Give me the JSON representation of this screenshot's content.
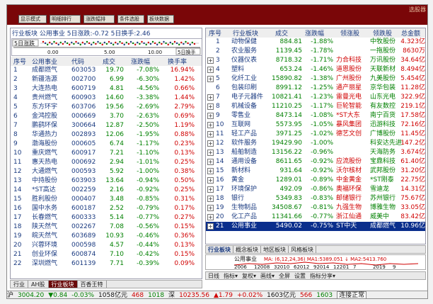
{
  "title_bar": {
    "left_text": "",
    "right_text": "选股器"
  },
  "toolbar": [
    "显示模式",
    "明细排行",
    "涨跌幅排",
    "条件选股",
    "板块数据"
  ],
  "left_panel": {
    "header": "行业板块 公用事业 5日涨跌:-0.72 5日换手:2.46",
    "chart": {
      "tag": "5日涨跌",
      "axis": [
        "0.00",
        "5.00",
        "10.00"
      ],
      "right_label": "5日换手"
    },
    "columns": [
      "序号",
      "公用事业",
      "代码",
      "成交",
      "涨跌幅",
      "换手率"
    ],
    "rows": [
      {
        "n": "1",
        "name": "成都燃气",
        "code": "603053",
        "price": "19.70",
        "chg": "-7.08%",
        "turn": "16.94%"
      },
      {
        "n": "2",
        "name": "新疆浩源",
        "code": "002700",
        "price": "6.99",
        "chg": "-6.30%",
        "turn": "1.42%"
      },
      {
        "n": "3",
        "name": "大连热电",
        "code": "600719",
        "price": "4.81",
        "chg": "-4.56%",
        "turn": "0.66%"
      },
      {
        "n": "4",
        "name": "贵州燃气",
        "code": "600903",
        "price": "14.60",
        "chg": "-3.38%",
        "turn": "1.44%"
      },
      {
        "n": "5",
        "name": "东方环宇",
        "code": "603706",
        "price": "19.56",
        "chg": "-2.69%",
        "turn": "2.79%"
      },
      {
        "n": "6",
        "name": "金鸿控股",
        "code": "000669",
        "price": "3.70",
        "chg": "-2.63%",
        "turn": "0.69%"
      },
      {
        "n": "7",
        "name": "鹏鹞环保",
        "code": "300664",
        "price": "12.87",
        "chg": "-2.50%",
        "turn": "1.19%"
      },
      {
        "n": "8",
        "name": "华通热力",
        "code": "002893",
        "price": "12.06",
        "chg": "-1.95%",
        "turn": "0.88%"
      },
      {
        "n": "9",
        "name": "渤海股份",
        "code": "000605",
        "price": "6.74",
        "chg": "-1.17%",
        "turn": "0.23%"
      },
      {
        "n": "10",
        "name": "重庆燃气",
        "code": "600917",
        "price": "7.21",
        "chg": "-1.10%",
        "turn": "0.13%"
      },
      {
        "n": "11",
        "name": "惠天热电",
        "code": "000692",
        "price": "2.94",
        "chg": "-1.01%",
        "turn": "0.25%"
      },
      {
        "n": "12",
        "name": "大通燃气",
        "code": "000593",
        "price": "5.92",
        "chg": "-1.00%",
        "turn": "0.38%"
      },
      {
        "n": "13",
        "name": "中持股份",
        "code": "603903",
        "price": "13.64",
        "chg": "-0.94%",
        "turn": "0.50%"
      },
      {
        "n": "14",
        "name": "*ST高达",
        "code": "002259",
        "price": "2.16",
        "chg": "-0.92%",
        "turn": "0.25%"
      },
      {
        "n": "15",
        "name": "胜利股份",
        "code": "000407",
        "price": "3.48",
        "chg": "-0.85%",
        "turn": "0.31%"
      },
      {
        "n": "16",
        "name": "国中水务",
        "code": "600187",
        "price": "2.52",
        "chg": "-0.79%",
        "turn": "0.17%"
      },
      {
        "n": "17",
        "name": "长春燃气",
        "code": "600333",
        "price": "5.14",
        "chg": "-0.77%",
        "turn": "0.27%"
      },
      {
        "n": "18",
        "name": "陕天然气",
        "code": "002267",
        "price": "7.08",
        "chg": "-0.56%",
        "turn": "0.15%"
      },
      {
        "n": "19",
        "name": "皖天然气",
        "code": "603689",
        "price": "10.93",
        "chg": "-0.46%",
        "turn": "0.36%"
      },
      {
        "n": "20",
        "name": "兴蓉环境",
        "code": "000598",
        "price": "4.57",
        "chg": "-0.44%",
        "turn": "0.13%"
      },
      {
        "n": "21",
        "name": "创业环保",
        "code": "600874",
        "price": "7.10",
        "chg": "-0.42%",
        "turn": "0.15%"
      },
      {
        "n": "22",
        "name": "深圳燃气",
        "code": "601139",
        "price": "7.71",
        "chg": "-0.39%",
        "turn": "0.09%"
      }
    ]
  },
  "right_panel": {
    "columns": [
      "序号",
      "行业板块",
      "成交",
      "涨跌幅",
      "领涨股",
      "领跌股",
      "总金额"
    ],
    "rows": [
      {
        "n": "1",
        "name": "动物保健",
        "price": "884.81",
        "chg": "-1.88%",
        "up": "",
        "down": "中牧股份",
        "amt": "4.323亿"
      },
      {
        "n": "2",
        "name": "农业服务",
        "price": "1139.45",
        "chg": "-1.78%",
        "up": "",
        "down": "一拖股份",
        "amt": "8630万"
      },
      {
        "n": "3",
        "name": "仪器仪表",
        "price": "8718.32",
        "chg": "-1.71%",
        "up": "力合科技",
        "down": "万讯股份",
        "amt": "34.64亿"
      },
      {
        "n": "4",
        "name": "塑料",
        "price": "653.24",
        "chg": "-1.46%",
        "up": "道恩股份",
        "down": "天联新材",
        "amt": "8.494亿"
      },
      {
        "n": "5",
        "name": "化纤工业",
        "price": "15890.82",
        "chg": "-1.38%",
        "up": "广州股份",
        "down": "九美股份",
        "amt": "5.454亿"
      },
      {
        "n": "6",
        "name": "包装印刷",
        "price": "8991.12",
        "chg": "-1.25%",
        "up": "通产丽星",
        "down": "京华包装",
        "amt": "11.28亿"
      },
      {
        "n": "7",
        "name": "电子元器件",
        "price": "10821.41",
        "chg": "-1.23%",
        "up": "雷曼光电",
        "down": "山东光电",
        "amt": "322.9亿"
      },
      {
        "n": "8",
        "name": "机械设备",
        "price": "11210.25",
        "chg": "-1.17%",
        "up": "巨轮智能",
        "down": "有友数控",
        "amt": "219.1亿"
      },
      {
        "n": "9",
        "name": "零售业",
        "price": "8473.14",
        "chg": "-1.08%",
        "up": "*ST大东",
        "down": "南宁百货",
        "amt": "17.58亿"
      },
      {
        "n": "10",
        "name": "互联网",
        "price": "5573.95",
        "chg": "-1.05%",
        "up": "暴风集团",
        "down": "迅游科技",
        "amt": "72.16亿"
      },
      {
        "n": "11",
        "name": "轻工产品",
        "price": "3971.25",
        "chg": "-1.02%",
        "up": "德艺文创",
        "down": "广博股份",
        "amt": "11.45亿"
      },
      {
        "n": "12",
        "name": "软件服务",
        "price": "19429.90",
        "chg": "-1.00%",
        "up": "",
        "down": "科安达先进通",
        "amt": "147.2亿"
      },
      {
        "n": "13",
        "name": "船舶制造",
        "price": "13156.22",
        "chg": "-0.96%",
        "up": "",
        "down": "天海防务",
        "amt": "3.674亿"
      },
      {
        "n": "14",
        "name": "通用设备",
        "price": "8611.65",
        "chg": "-0.92%",
        "up": "应流股份",
        "down": "宝鼎科技",
        "amt": "61.40亿"
      },
      {
        "n": "15",
        "name": "新材料",
        "price": "931.64",
        "chg": "-0.92%",
        "up": "沃尔核材",
        "down": "武邦股份",
        "amt": "31.20亿"
      },
      {
        "n": "16",
        "name": "黄金",
        "price": "1289.01",
        "chg": "-0.89%",
        "up": "中金黄金",
        "down": "*ST刚泰",
        "amt": "22.75亿"
      },
      {
        "n": "17",
        "name": "环境保护",
        "price": "492.09",
        "chg": "-0.86%",
        "up": "奥福环保",
        "down": "雪迪龙",
        "amt": "14.31亿"
      },
      {
        "n": "18",
        "name": "银行",
        "price": "5349.83",
        "chg": "-0.83%",
        "up": "邮储银行",
        "down": "苏州银行",
        "amt": "75.67亿"
      },
      {
        "n": "19",
        "name": "生物制品",
        "price": "34508.67",
        "chg": "-0.81%",
        "up": "九强生物",
        "down": "博雅生物",
        "amt": "33.05亿"
      },
      {
        "n": "20",
        "name": "化工产品",
        "price": "11341.66",
        "chg": "-0.77%",
        "up": "浙江仙通",
        "down": "威美中",
        "amt": "83.42亿"
      },
      {
        "n": "21",
        "name": "公用事业",
        "price": "5490.02",
        "chg": "-0.75%",
        "up": "ST中天",
        "down": "成都燃气",
        "amt": "10.96亿"
      }
    ]
  },
  "right_tabs": [
    "行业板块",
    "概念板块",
    "地区板块",
    "风格板块"
  ],
  "mini_chart": {
    "label": "公用事业",
    "ma_text": "MA: (6,12,24,36) MA1:5389.051 ↓ MA2:5413.760",
    "years": [
      "2006",
      "12008",
      "32010",
      "62012",
      "92014",
      "12201",
      "7",
      "2019",
      "9"
    ]
  },
  "left_tabs": [
    "行业",
    "AH股",
    "行业板块",
    "百香王特"
  ],
  "right_bottom": [
    "日线",
    "指标▾",
    "复权▾",
    "画线▾",
    "全屏",
    "设置",
    "指标分享▾"
  ],
  "status_bar": {
    "sh_name": "沪",
    "sh_index": "3004.20",
    "sh_chg": "▼0.84",
    "sh_pct": "-0.03%",
    "sh_amt": "1058亿元",
    "sh_up": "468",
    "sh_down": "1018",
    "sz_name": "深",
    "sz_index": "10235.56",
    "sz_chg": "▲1.79",
    "sz_pct": "+0.02%",
    "sz_amt": "1603亿元",
    "sz_up": "566",
    "sz_down": "1603",
    "conn": "连接正常"
  }
}
